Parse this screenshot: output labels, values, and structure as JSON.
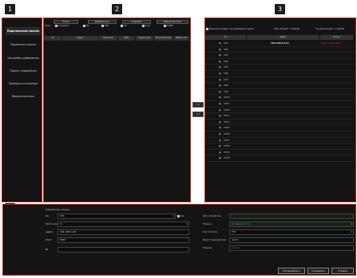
{
  "markers": [
    "1",
    "2",
    "3",
    "4"
  ],
  "sidebar": {
    "items": [
      {
        "label": "Подключение канала",
        "active": true
      },
      {
        "label": "Параметры канала",
        "active": false
      },
      {
        "label": "Настройка добавления",
        "active": false
      },
      {
        "label": "Проект управления",
        "active": false
      },
      {
        "label": "Проверка на наличие",
        "active": false
      },
      {
        "label": "Видеоаналитика",
        "active": false
      }
    ]
  },
  "search_panel": {
    "buttons": [
      "Поиск",
      "Добавить все",
      "Подробно",
      "Импорт/Экспорт"
    ],
    "filter_label": "Фильт",
    "filters": [
      "IA1/IA2/IAT",
      "IPC",
      "NVR",
      "HD",
      "Tenel",
      "ELSBE"
    ],
    "columns": [
      "№",
      "Адрес",
      "Протокол",
      "MAC",
      "Подключен",
      "Об устройстве",
      "Status info"
    ]
  },
  "arrows": {
    "add": ">>",
    "remove": "<<"
  },
  "channel_panel": {
    "option_label": "Назначить IP-адрес при добавлении канала",
    "max_bandwidth": "Макс. битрейт : 0.000000",
    "current_bandwidth": "Текущий битрейт : 0.000000",
    "columns": [
      "№",
      "Адрес",
      "Статус"
    ],
    "rows": [
      {
        "ch": "CH1",
        "address": "192.168.0.123",
        "status": "Сбой соединения"
      },
      {
        "ch": "CH2",
        "address": "",
        "status": ""
      },
      {
        "ch": "CH3",
        "address": "",
        "status": ""
      },
      {
        "ch": "CH4",
        "address": "",
        "status": ""
      },
      {
        "ch": "CH5",
        "address": "",
        "status": ""
      },
      {
        "ch": "CH6",
        "address": "",
        "status": ""
      },
      {
        "ch": "CH7",
        "address": "",
        "status": ""
      },
      {
        "ch": "CH8",
        "address": "",
        "status": ""
      },
      {
        "ch": "CH9",
        "address": "",
        "status": ""
      },
      {
        "ch": "CH10",
        "address": "",
        "status": ""
      },
      {
        "ch": "CH11",
        "address": "",
        "status": ""
      },
      {
        "ch": "CH12",
        "address": "",
        "status": ""
      },
      {
        "ch": "CH13",
        "address": "",
        "status": ""
      },
      {
        "ch": "CH14",
        "address": "",
        "status": ""
      },
      {
        "ch": "CH15",
        "address": "",
        "status": ""
      },
      {
        "ch": "CH16",
        "address": "",
        "status": ""
      },
      {
        "ch": "CH17",
        "address": "",
        "status": ""
      },
      {
        "ch": "CH18",
        "address": "",
        "status": ""
      },
      {
        "ch": "CH19",
        "address": "",
        "status": ""
      },
      {
        "ch": "CH20",
        "address": "",
        "status": ""
      }
    ]
  },
  "params": {
    "title": "Параметры канала",
    "channel_label": "Кл",
    "channel_value": "CH1",
    "all_label": "Все",
    "protocol_label": "Протокол",
    "protocol_value": "IA",
    "address_label": "Адрес",
    "address_value": "192.168.0.123",
    "port_label": "Порт",
    "port_value": "8000",
    "no_label": "№",
    "no_value": "",
    "device_label": "Об устройстве",
    "device_value": "",
    "mode_label": "Режим",
    "mode_value": "Основной поток",
    "transport_label": "Тип потока",
    "transport_value": "TCP",
    "user_label": "Имя пользователя",
    "user_value": "admin",
    "password_label": "Пароль",
    "password_value": "••••••"
  },
  "footer_buttons": {
    "copy": "Копировать в",
    "save": "Сохранить",
    "cancel": "Отмена"
  },
  "colors": {
    "accent": "#c0281c",
    "background": "#141414",
    "error": "#e03a2a"
  }
}
